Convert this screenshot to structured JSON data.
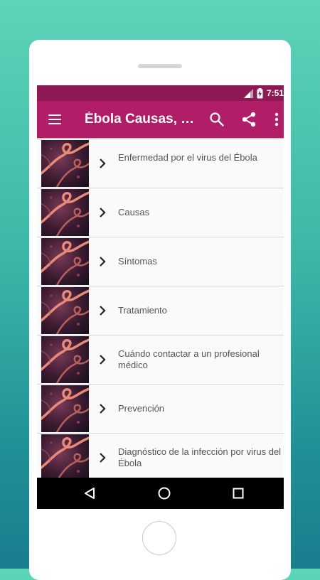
{
  "status_bar": {
    "time": "7:51"
  },
  "app_bar": {
    "title": "Ébola Causas, síntomas y tratamiento"
  },
  "list_items": [
    {
      "label": "Enfermedad por el virus del Ébola"
    },
    {
      "label": "Causas"
    },
    {
      "label": "Síntomas"
    },
    {
      "label": "Tratamiento"
    },
    {
      "label": "Cuándo contactar a un profesional médico"
    },
    {
      "label": "Prevención"
    },
    {
      "label": "Diagnóstico de la infección por virus del Ébola"
    }
  ],
  "icons": {
    "menu": "menu-icon",
    "search": "search-icon",
    "share": "share-icon",
    "more": "more-vert-icon",
    "chevron": "chevron-right-icon",
    "back": "back-triangle-icon",
    "home": "home-circle-icon",
    "recents": "recents-square-icon"
  },
  "colors": {
    "status_bar": "#8e1a55",
    "app_bar": "#b21d67",
    "background_top": "#5cd4b8",
    "background_bottom": "#197e8e"
  }
}
